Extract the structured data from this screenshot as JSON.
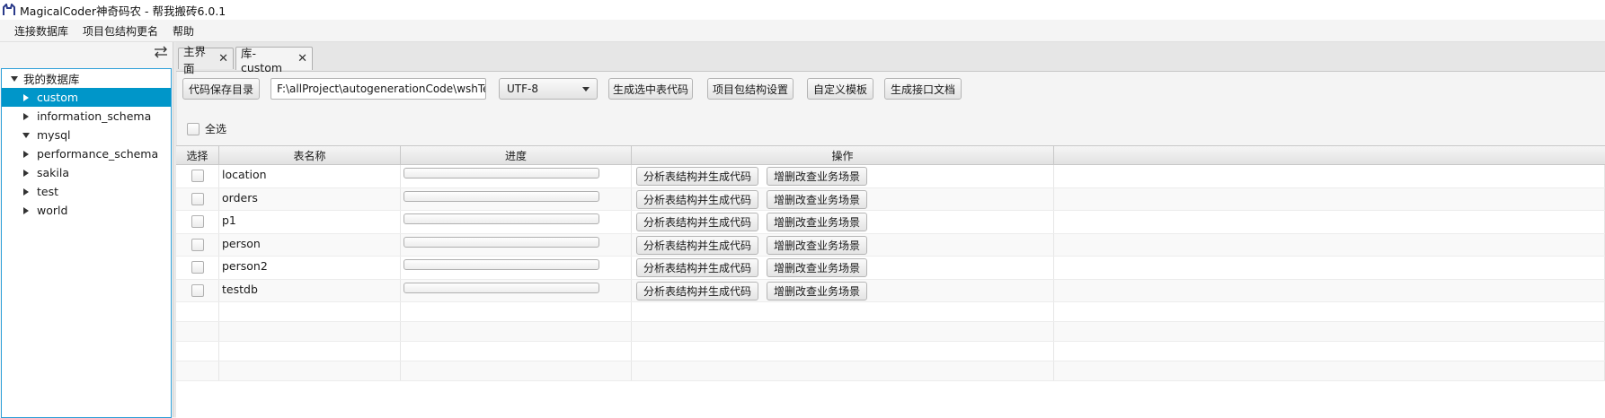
{
  "window": {
    "title": "MagicalCoder神奇码农 - 帮我搬砖6.0.1",
    "app_icon": "cat-logo-icon"
  },
  "menu": [
    "连接数据库",
    "项目包结构更名",
    "帮助"
  ],
  "tree": {
    "root": "我的数据库",
    "databases": [
      {
        "name": "custom",
        "selected": true,
        "expanded": false
      },
      {
        "name": "information_schema",
        "expanded": false
      },
      {
        "name": "mysql",
        "expanded": true
      },
      {
        "name": "performance_schema",
        "expanded": false
      },
      {
        "name": "sakila",
        "expanded": false
      },
      {
        "name": "test",
        "expanded": false
      },
      {
        "name": "world",
        "expanded": false
      }
    ]
  },
  "tabs": [
    {
      "label": "主界面",
      "close": "✕"
    },
    {
      "label": "库-custom",
      "close": "✕",
      "active": true
    }
  ],
  "toolbar": {
    "save_dir_label": "代码保存目录",
    "save_dir_value": "F:\\allProject\\autogenerationCode\\wshTe",
    "encoding": "UTF-8",
    "gen_selected_label": "生成选中表代码",
    "package_settings_label": "项目包结构设置",
    "custom_template_label": "自定义模板",
    "gen_api_doc_label": "生成接口文档"
  },
  "select_all_label": "全选",
  "table": {
    "headers": [
      "选择",
      "表名称",
      "进度",
      "操作"
    ],
    "rows": [
      "location",
      "orders",
      "p1",
      "person",
      "person2",
      "testdb"
    ],
    "action1_label": "分析表结构并生成代码",
    "action2_label": "增删改查业务场景",
    "empty_rows": 4
  }
}
